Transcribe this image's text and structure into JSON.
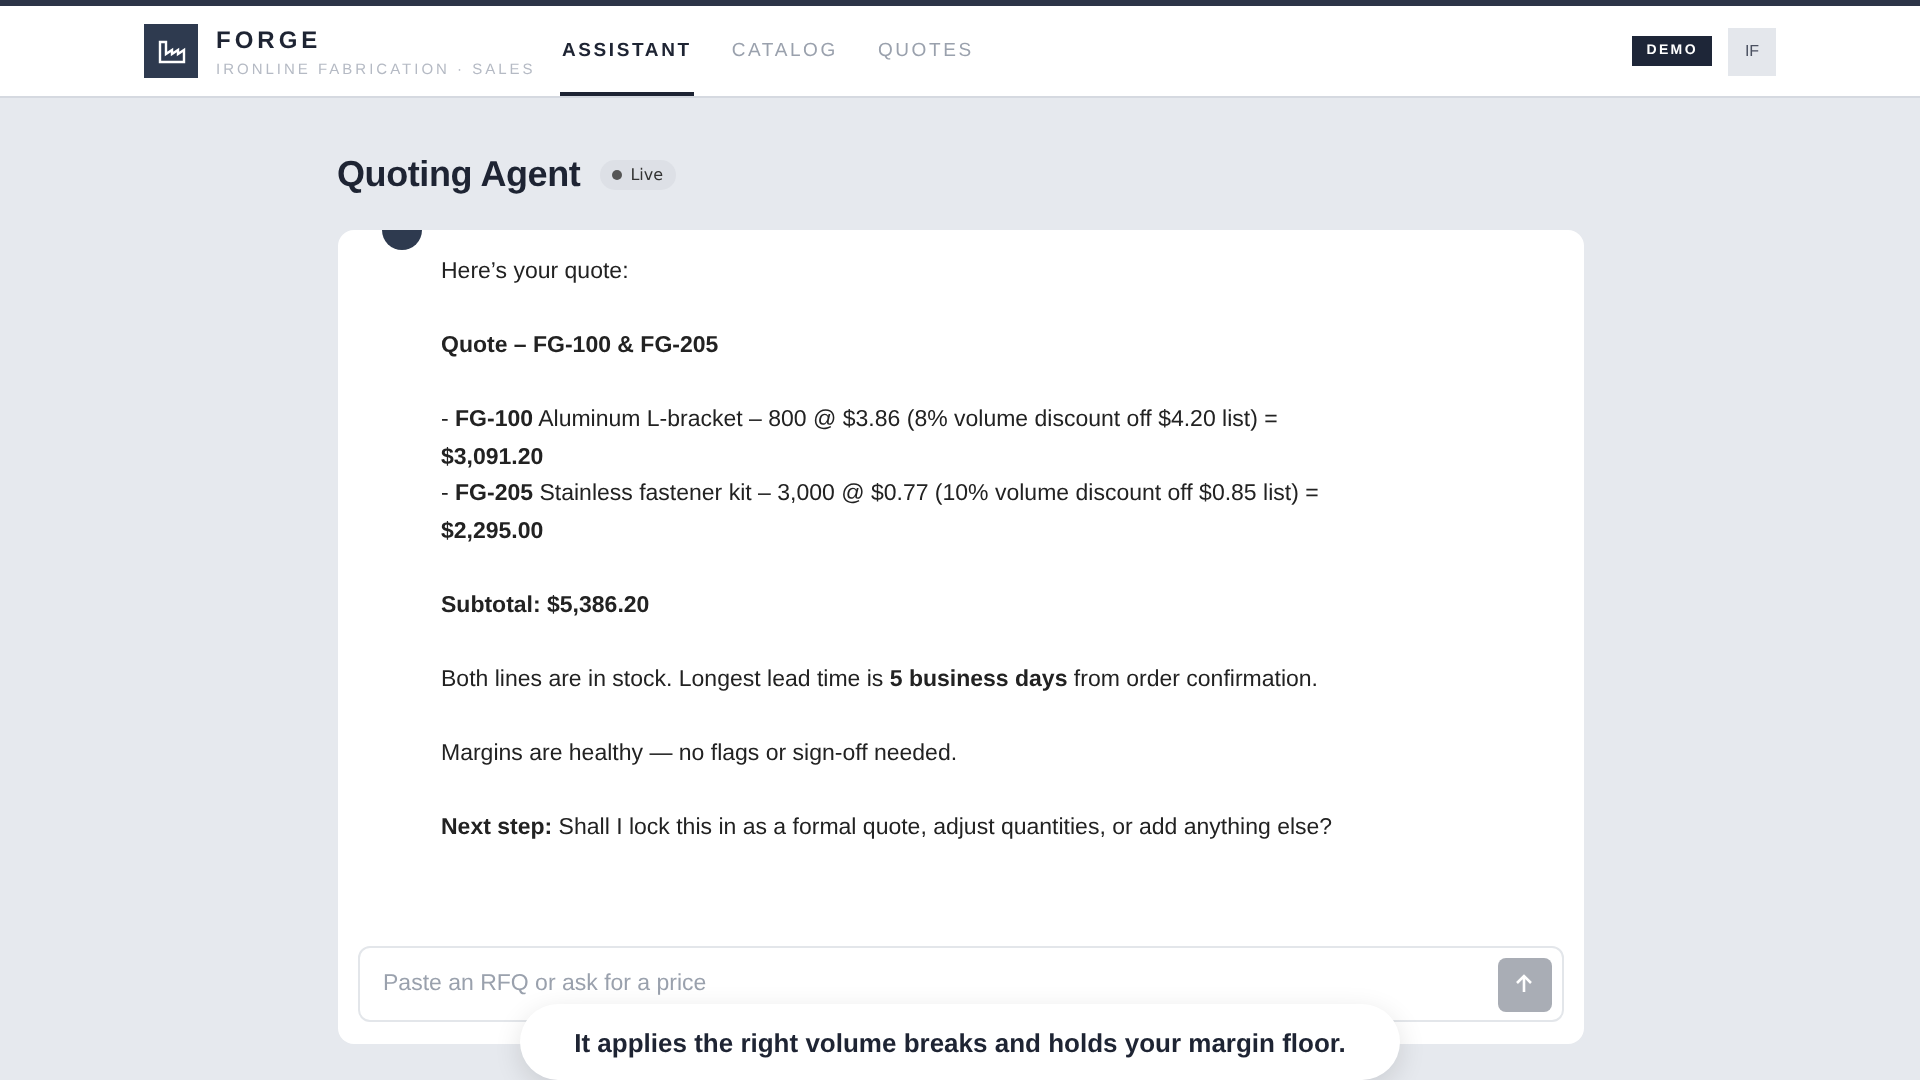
{
  "brand": {
    "name": "FORGE",
    "subtitle": "IRONLINE FABRICATION · SALES"
  },
  "tabs": [
    {
      "label": "ASSISTANT",
      "selected": true
    },
    {
      "label": "CATALOG",
      "selected": false
    },
    {
      "label": "QUOTES",
      "selected": false
    }
  ],
  "badge": "DEMO",
  "user_initials": "IF",
  "page": {
    "title": "Quoting Agent",
    "status": "Live"
  },
  "message": {
    "paragraphs": [
      "Here’s your quote:",
      "**Quote – FG-100 & FG-205**",
      "- **FG-100** Aluminum L-bracket – 800 @ $3.86 (8% volume discount off $4.20 list) = **$3,091.20**\n- **FG-205** Stainless fastener kit – 3,000 @ $0.77 (10% volume discount off $0.85 list) = **$2,295.00**",
      "**Subtotal: $5,386.20**",
      "Both lines are in stock. Longest lead time is **5 business days** from order confirmation.",
      "Margins are healthy — no flags or sign-off needed.",
      "**Next step:** Shall I lock this in as a formal quote, adjust quantities, or add anything else?"
    ]
  },
  "composer": {
    "placeholder": "Paste an RFQ or ask for a price",
    "send_disabled": true
  },
  "caption": "It applies the right volume breaks and holds your margin floor."
}
